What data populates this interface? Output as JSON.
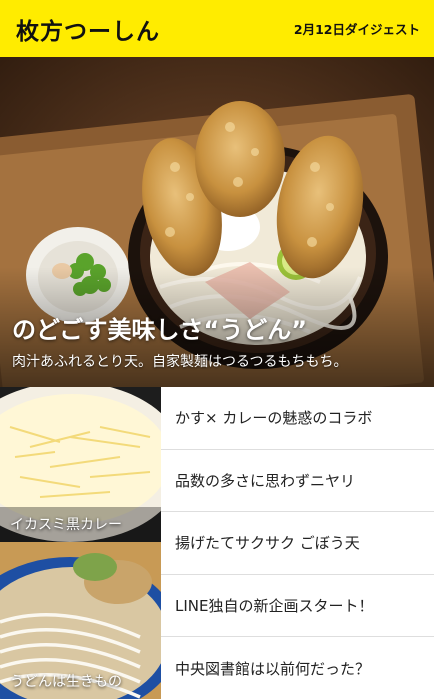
{
  "header": {
    "logo": "枚方つーしん",
    "digest": "2月12日ダイジェスト"
  },
  "hero": {
    "title": "のどごす美味しさ“うどん”",
    "subtitle": "肉汁あふれるとり天。自家製麺はつるつるもちもち。"
  },
  "thumbnails": [
    {
      "caption": "イカスミ黒カレー"
    },
    {
      "caption": "うどんは生きもの"
    }
  ],
  "articles": [
    {
      "title": "かす× カレーの魅惑のコラボ"
    },
    {
      "title": "品数の多さに思わずニヤリ"
    },
    {
      "title": "揚げたてサクサク ごぼう天"
    },
    {
      "title": "LINE独自の新企画スタート！"
    },
    {
      "title": "中央図書館は以前何だった？"
    }
  ],
  "colors": {
    "brand_yellow": "#ffec00",
    "text": "#222222",
    "divider": "#dedede"
  }
}
